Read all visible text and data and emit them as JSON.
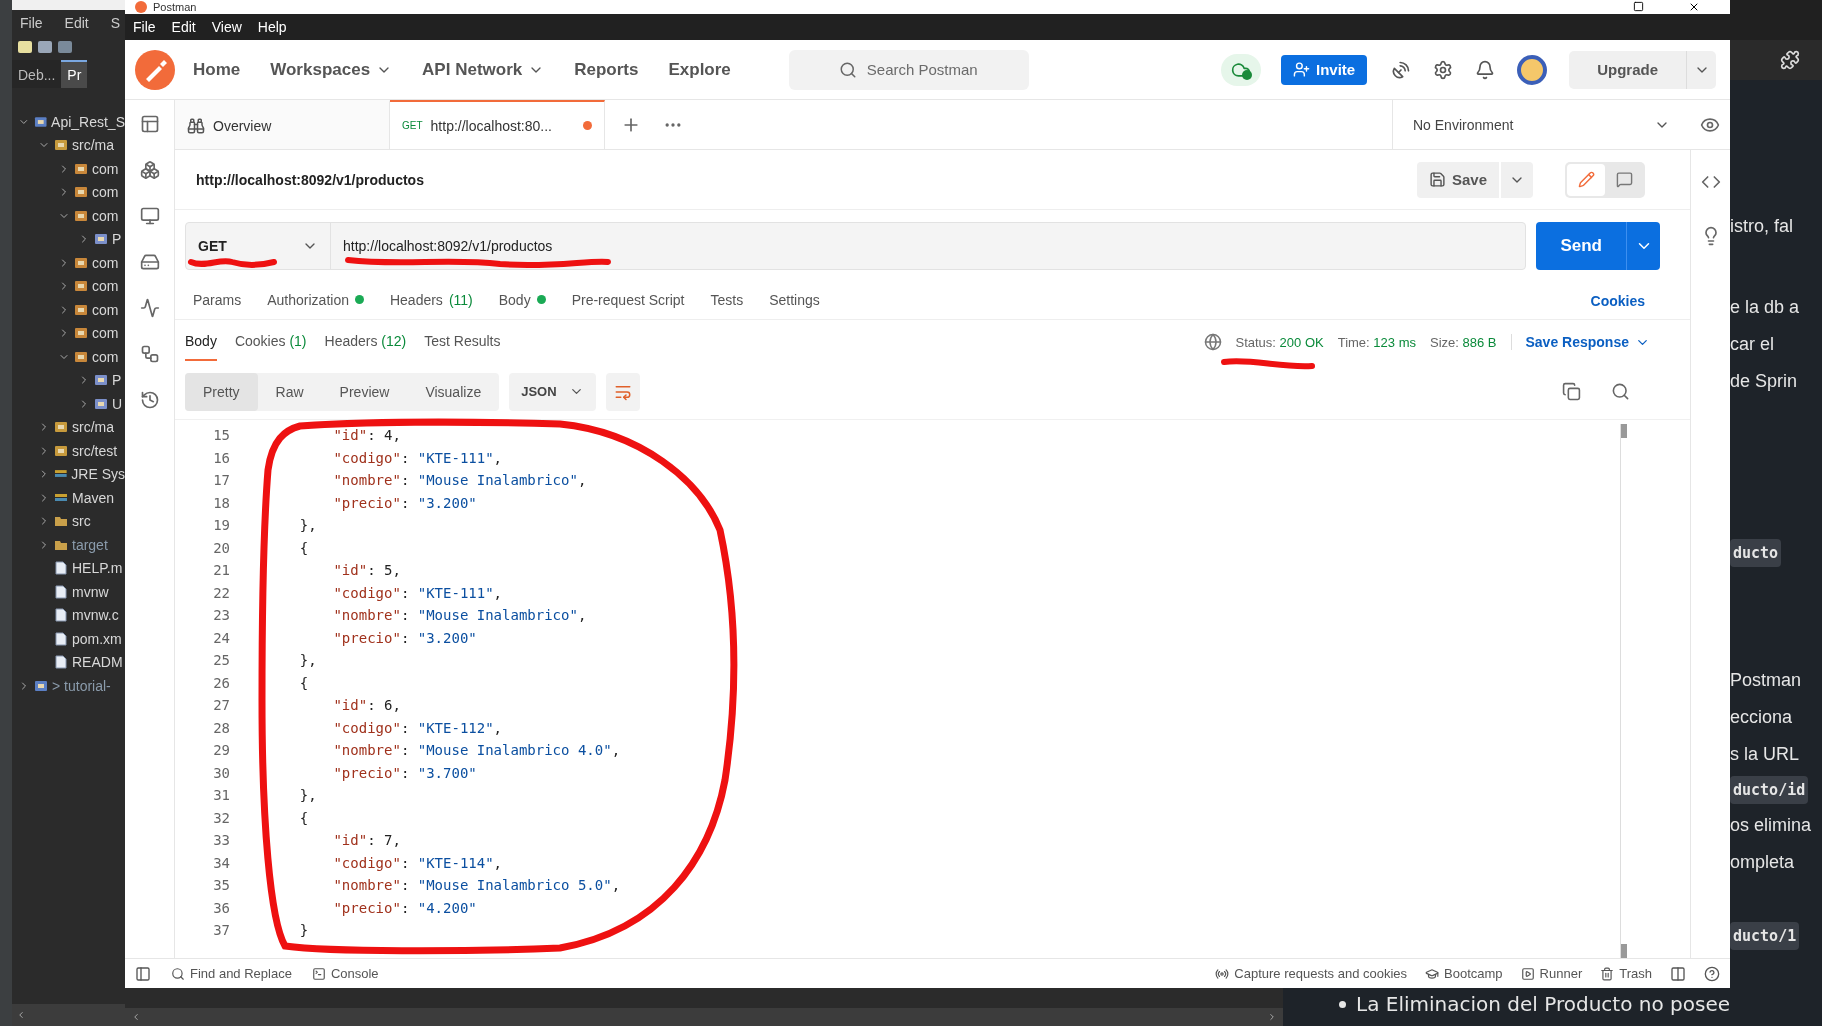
{
  "eclipse": {
    "menu": [
      "File",
      "Edit",
      "S"
    ],
    "tabs": [
      {
        "label": "Deb...",
        "selected": false
      },
      {
        "label": "Pr",
        "selected": true
      }
    ],
    "tree": [
      {
        "label": "Api_Rest_S",
        "kind": "project",
        "expanded": true,
        "dimmed": false,
        "children": [
          {
            "label": "src/ma",
            "kind": "srcfolder",
            "expanded": true,
            "dimmed": false,
            "children": [
              {
                "label": "com",
                "kind": "package",
                "expanded": false,
                "dimmed": false
              },
              {
                "label": "com",
                "kind": "package",
                "expanded": false,
                "dimmed": false
              },
              {
                "label": "com",
                "kind": "package",
                "expanded": true,
                "dimmed": false,
                "children": [
                  {
                    "label": "P",
                    "kind": "javafile",
                    "expanded": false,
                    "dimmed": false
                  }
                ]
              },
              {
                "label": "com",
                "kind": "package",
                "expanded": false,
                "dimmed": false
              },
              {
                "label": "com",
                "kind": "package",
                "expanded": false,
                "dimmed": false
              },
              {
                "label": "com",
                "kind": "package",
                "expanded": false,
                "dimmed": false
              },
              {
                "label": "com",
                "kind": "package",
                "expanded": false,
                "dimmed": false
              },
              {
                "label": "com",
                "kind": "package",
                "expanded": true,
                "dimmed": false,
                "children": [
                  {
                    "label": "P",
                    "kind": "javafile",
                    "expanded": false,
                    "dimmed": false
                  },
                  {
                    "label": "U",
                    "kind": "javafile",
                    "expanded": false,
                    "dimmed": false
                  }
                ]
              }
            ]
          },
          {
            "label": "src/ma",
            "kind": "srcfolder",
            "expanded": false,
            "dimmed": false
          },
          {
            "label": "src/test",
            "kind": "srcfolder",
            "expanded": false,
            "dimmed": false
          },
          {
            "label": "JRE Sys",
            "kind": "library",
            "expanded": false,
            "dimmed": false
          },
          {
            "label": "Maven",
            "kind": "library",
            "expanded": false,
            "dimmed": false
          },
          {
            "label": "src",
            "kind": "folder",
            "expanded": false,
            "dimmed": false
          },
          {
            "label": "target",
            "kind": "folder",
            "expanded": false,
            "dimmed": true
          },
          {
            "label": "HELP.m",
            "kind": "file",
            "dimmed": false
          },
          {
            "label": "mvnw",
            "kind": "file",
            "dimmed": false
          },
          {
            "label": "mvnw.c",
            "kind": "file",
            "dimmed": false
          },
          {
            "label": "pom.xm",
            "kind": "file",
            "dimmed": false
          },
          {
            "label": "READM",
            "kind": "file",
            "dimmed": false
          }
        ]
      },
      {
        "label": "> tutorial-",
        "kind": "project",
        "expanded": false,
        "dimmed": true
      }
    ]
  },
  "postman": {
    "title": "Postman",
    "menu": [
      "File",
      "Edit",
      "View",
      "Help"
    ],
    "nav": [
      {
        "label": "Home",
        "dropdown": false
      },
      {
        "label": "Workspaces",
        "dropdown": true
      },
      {
        "label": "API Network",
        "dropdown": true
      },
      {
        "label": "Reports",
        "dropdown": false
      },
      {
        "label": "Explore",
        "dropdown": false
      }
    ],
    "search": {
      "placeholder": "Search Postman"
    },
    "invite": "Invite",
    "upgrade": "Upgrade",
    "tabs": [
      {
        "kind": "overview",
        "label": "Overview",
        "selected": false
      },
      {
        "kind": "request",
        "method": "GET",
        "label": "http://localhost:80...",
        "selected": true,
        "unsaved": true
      }
    ],
    "environment": "No Environment",
    "request": {
      "name": "http://localhost:8092/v1/productos",
      "save": "Save",
      "method": "GET",
      "url": "http://localhost:8092/v1/productos",
      "send": "Send",
      "cookies": "Cookies",
      "tabs": [
        {
          "label": "Params",
          "dot": false,
          "selected": false
        },
        {
          "label": "Authorization",
          "dot": true,
          "selected": false
        },
        {
          "label": "Headers",
          "count": "(11)",
          "dot": false,
          "selected": false
        },
        {
          "label": "Body",
          "dot": true,
          "selected": false
        },
        {
          "label": "Pre-request Script",
          "dot": false,
          "selected": false
        },
        {
          "label": "Tests",
          "dot": false,
          "selected": false
        },
        {
          "label": "Settings",
          "dot": false,
          "selected": false
        }
      ]
    },
    "response": {
      "tabs": [
        {
          "label": "Body",
          "selected": true
        },
        {
          "label": "Cookies",
          "count": "(1)",
          "selected": false
        },
        {
          "label": "Headers",
          "count": "(12)",
          "selected": false
        },
        {
          "label": "Test Results",
          "selected": false
        }
      ],
      "status_label": "Status:",
      "status": "200 OK",
      "time_label": "Time:",
      "time": "123 ms",
      "size_label": "Size:",
      "size": "886 B",
      "save_response": "Save Response",
      "views": [
        {
          "label": "Pretty",
          "selected": true
        },
        {
          "label": "Raw",
          "selected": false
        },
        {
          "label": "Preview",
          "selected": false
        },
        {
          "label": "Visualize",
          "selected": false
        }
      ],
      "format": "JSON",
      "lines": [
        {
          "number": "15",
          "text": "        \"id\": 4,"
        },
        {
          "number": "16",
          "text": "        \"codigo\": \"KTE-111\","
        },
        {
          "number": "17",
          "text": "        \"nombre\": \"Mouse Inalambrico\","
        },
        {
          "number": "18",
          "text": "        \"precio\": \"3.200\""
        },
        {
          "number": "19",
          "text": "    },"
        },
        {
          "number": "20",
          "text": "    {"
        },
        {
          "number": "21",
          "text": "        \"id\": 5,"
        },
        {
          "number": "22",
          "text": "        \"codigo\": \"KTE-111\","
        },
        {
          "number": "23",
          "text": "        \"nombre\": \"Mouse Inalambrico\","
        },
        {
          "number": "24",
          "text": "        \"precio\": \"3.200\""
        },
        {
          "number": "25",
          "text": "    },"
        },
        {
          "number": "26",
          "text": "    {"
        },
        {
          "number": "27",
          "text": "        \"id\": 6,"
        },
        {
          "number": "28",
          "text": "        \"codigo\": \"KTE-112\","
        },
        {
          "number": "29",
          "text": "        \"nombre\": \"Mouse Inalambrico 4.0\","
        },
        {
          "number": "30",
          "text": "        \"precio\": \"3.700\""
        },
        {
          "number": "31",
          "text": "    },"
        },
        {
          "number": "32",
          "text": "    {"
        },
        {
          "number": "33",
          "text": "        \"id\": 7,"
        },
        {
          "number": "34",
          "text": "        \"codigo\": \"KTE-114\","
        },
        {
          "number": "35",
          "text": "        \"nombre\": \"Mouse Inalambrico 5.0\","
        },
        {
          "number": "36",
          "text": "        \"precio\": \"4.200\""
        },
        {
          "number": "37",
          "text": "    }"
        }
      ]
    },
    "footer": {
      "left": [
        {
          "label": "Find and Replace"
        },
        {
          "label": "Console"
        }
      ],
      "right": [
        {
          "label": "Capture requests and cookies"
        },
        {
          "label": "Bootcamp"
        },
        {
          "label": "Runner"
        },
        {
          "label": "Trash"
        }
      ]
    }
  },
  "document": {
    "paragraphs": [
      [
        {
          "kind": "text",
          "text": "istro, fal"
        }
      ],
      [
        {
          "kind": "text",
          "text": "e la db a"
        },
        {
          "kind": "text",
          "text": "car el"
        },
        {
          "kind": "text",
          "text": "de Sprin"
        }
      ],
      [
        {
          "kind": "code",
          "text": "ducto"
        }
      ],
      [
        {
          "kind": "text",
          "text": "Postman"
        },
        {
          "kind": "text",
          "text": "ecciona"
        },
        {
          "kind": "text",
          "text": "s la URL"
        },
        {
          "kind": "code",
          "text": "ducto/id"
        },
        {
          "kind": "text",
          "text": "os elimina"
        },
        {
          "kind": "text",
          "text": "ompleta"
        }
      ],
      [
        {
          "kind": "code",
          "text": "ducto/1"
        }
      ]
    ],
    "bullet": "La Eliminacion del Producto no posee"
  }
}
